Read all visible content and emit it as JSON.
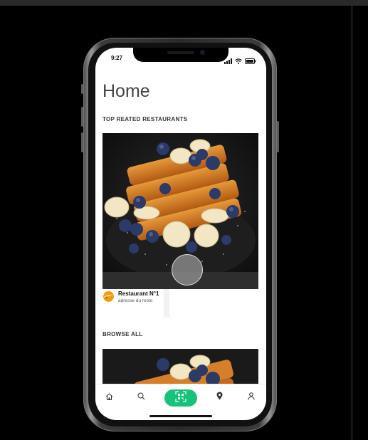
{
  "status_bar": {
    "time": "9:27"
  },
  "page": {
    "title": "Home"
  },
  "sections": {
    "top_rated": {
      "title": "TOP REATED RESTAURANTS"
    },
    "browse_all": {
      "title": "BROWSE ALL"
    }
  },
  "restaurant_card": {
    "name": "Restaurant N°1",
    "address": "adresse du resto"
  },
  "bottom_nav": {
    "items": [
      {
        "icon": "home-icon"
      },
      {
        "icon": "search-icon"
      },
      {
        "icon": "qr-scan-icon"
      },
      {
        "icon": "location-pin-icon"
      },
      {
        "icon": "profile-icon"
      }
    ]
  },
  "colors": {
    "accent": "#17c27a",
    "logo": "#f39c12"
  }
}
